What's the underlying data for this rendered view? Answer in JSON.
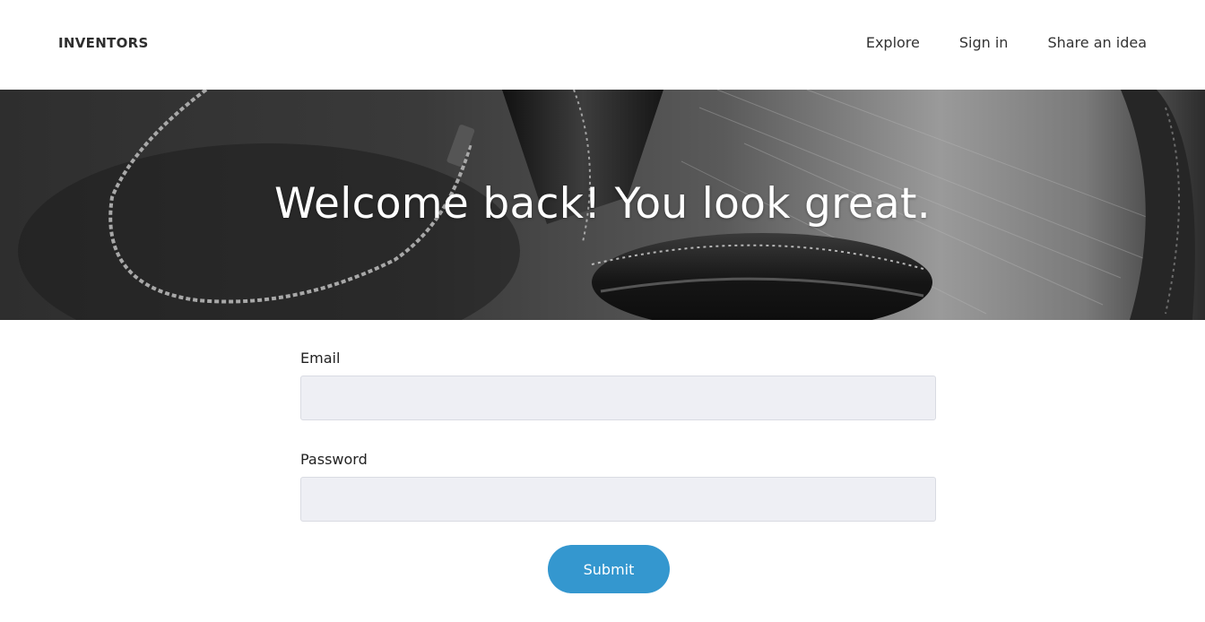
{
  "header": {
    "brand": "INVENTORS",
    "nav": [
      {
        "label": "Explore"
      },
      {
        "label": "Sign in"
      },
      {
        "label": "Share an idea"
      }
    ]
  },
  "hero": {
    "title": "Welcome back! You look great.",
    "image": "headphones-photo"
  },
  "form": {
    "email": {
      "label": "Email",
      "value": "",
      "placeholder": ""
    },
    "password": {
      "label": "Password",
      "value": "",
      "placeholder": ""
    },
    "submit_label": "Submit"
  },
  "colors": {
    "accent": "#3497cf",
    "input_bg": "#eeeff4",
    "hero_dark": "#2a2a2a"
  }
}
